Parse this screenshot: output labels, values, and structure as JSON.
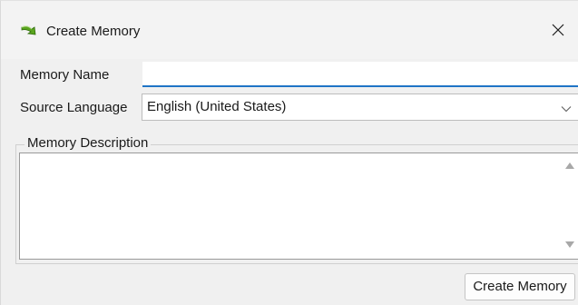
{
  "window": {
    "title": "Create Memory",
    "icon": "green-arrow-icon",
    "close_glyph": "✕"
  },
  "form": {
    "memory_name_label": "Memory Name",
    "memory_name_value": "",
    "source_language_label": "Source Language",
    "source_language_value": "English (United States)",
    "description_group_title": "Memory Description",
    "description_value": ""
  },
  "actions": {
    "create_label": "Create Memory"
  },
  "colors": {
    "focus_underline": "#1f74c6",
    "icon_green": "#5aa51e",
    "dialog_bg": "#f0f0f0"
  }
}
